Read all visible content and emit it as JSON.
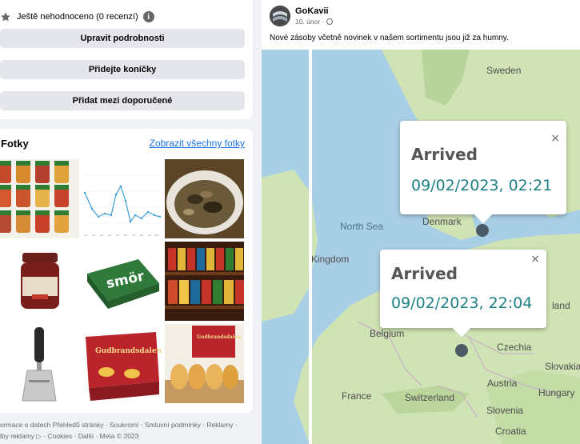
{
  "page_info": {
    "rating_text": "Ještě nehodnoceno (0 recenzí)",
    "info_icon": "i",
    "buttons": [
      "Upravit podrobnosti",
      "Přidejte koníčky",
      "Přidat mezi doporučené"
    ]
  },
  "photos": {
    "title": "Fotky",
    "see_all": "Zobrazit všechny fotky",
    "thumb_texts": {
      "smor": "smör",
      "cheese_brand": "Gudbrandsdalen",
      "cheese_brand2": "Gudbrandsdalen"
    },
    "chart_ticks": [
      "10",
      "20",
      "30",
      "40",
      "50",
      "60",
      "70",
      "80",
      "90",
      "100"
    ]
  },
  "footer": {
    "line1": "ormace o datech Přehledů stránky · Soukromí · Smluvní podmínky · Reklamy ·",
    "line2": "lby reklamy ▷ · Cookies · Další · Meta © 2023"
  },
  "post": {
    "author": "GoKavii",
    "date": "10. únor ·",
    "text": "Nové zásoby včetně novinek v našem sortimentu jsou již za humny.",
    "map": {
      "labels": {
        "sweden": "Sweden",
        "north_sea": "North Sea",
        "denmark": "Denmark",
        "kingdom": "Kingdom",
        "belgium": "Belgium",
        "czechia": "Czechia",
        "land": "land",
        "slovakia": "Slovakia",
        "austria": "Austria",
        "hungary": "Hungary",
        "france": "France",
        "switzerland": "Switzerland",
        "slovenia": "Slovenia",
        "croatia": "Croatia"
      },
      "popup1": {
        "title": "Arrived",
        "time": "09/02/2023, 02:21",
        "close": "×"
      },
      "popup2": {
        "title": "Arrived",
        "time": "09/02/2023, 22:04",
        "close": "×"
      }
    }
  },
  "colors": {
    "link": "#1b74e4",
    "button_bg": "#e4e6eb",
    "water": "#a9cfe6",
    "land": "#cfe3b4",
    "popup_time": "#1e8184",
    "marker": "#4a5a66"
  }
}
